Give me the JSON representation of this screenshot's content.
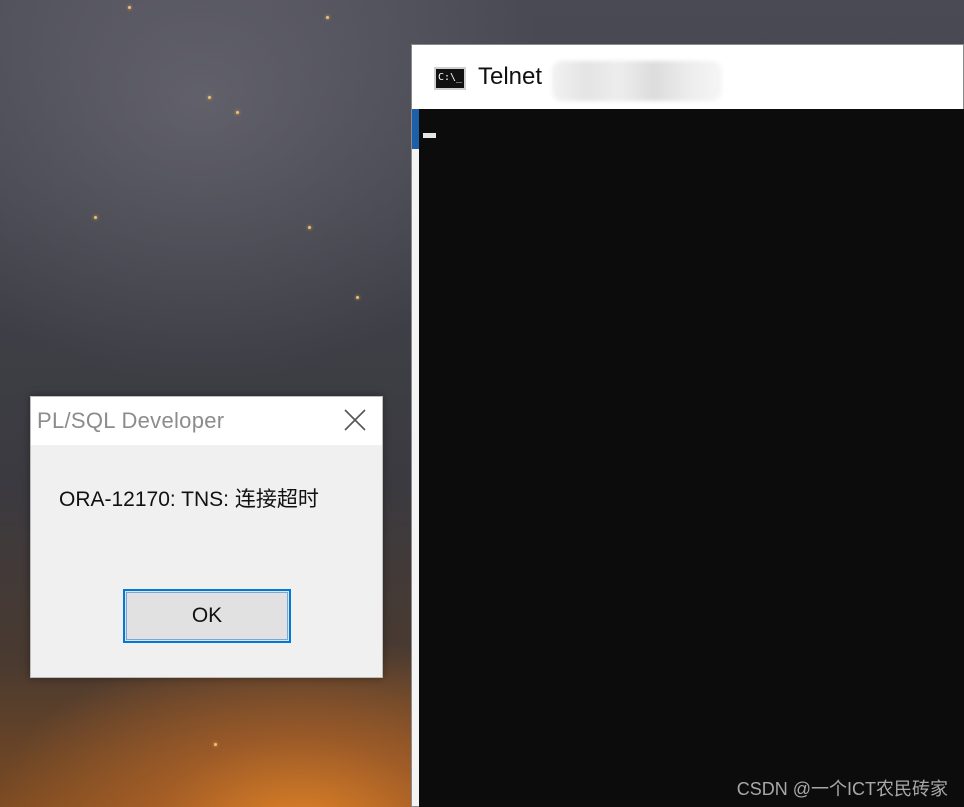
{
  "telnet_window": {
    "title": "Telnet",
    "icon": "cmd-icon",
    "icon_text": "C:\\_"
  },
  "plsql_dialog": {
    "title": "PL/SQL Developer",
    "message": "ORA-12170: TNS: 连接超时",
    "ok_label": "OK",
    "close_icon": "close-icon"
  },
  "watermark": "CSDN @一个ICT农民砖家",
  "colors": {
    "console_bg": "#0c0c0c",
    "dialog_bg": "#f0f0f0",
    "focus_border": "#0078d7",
    "title_gray": "#8c8c8c"
  }
}
